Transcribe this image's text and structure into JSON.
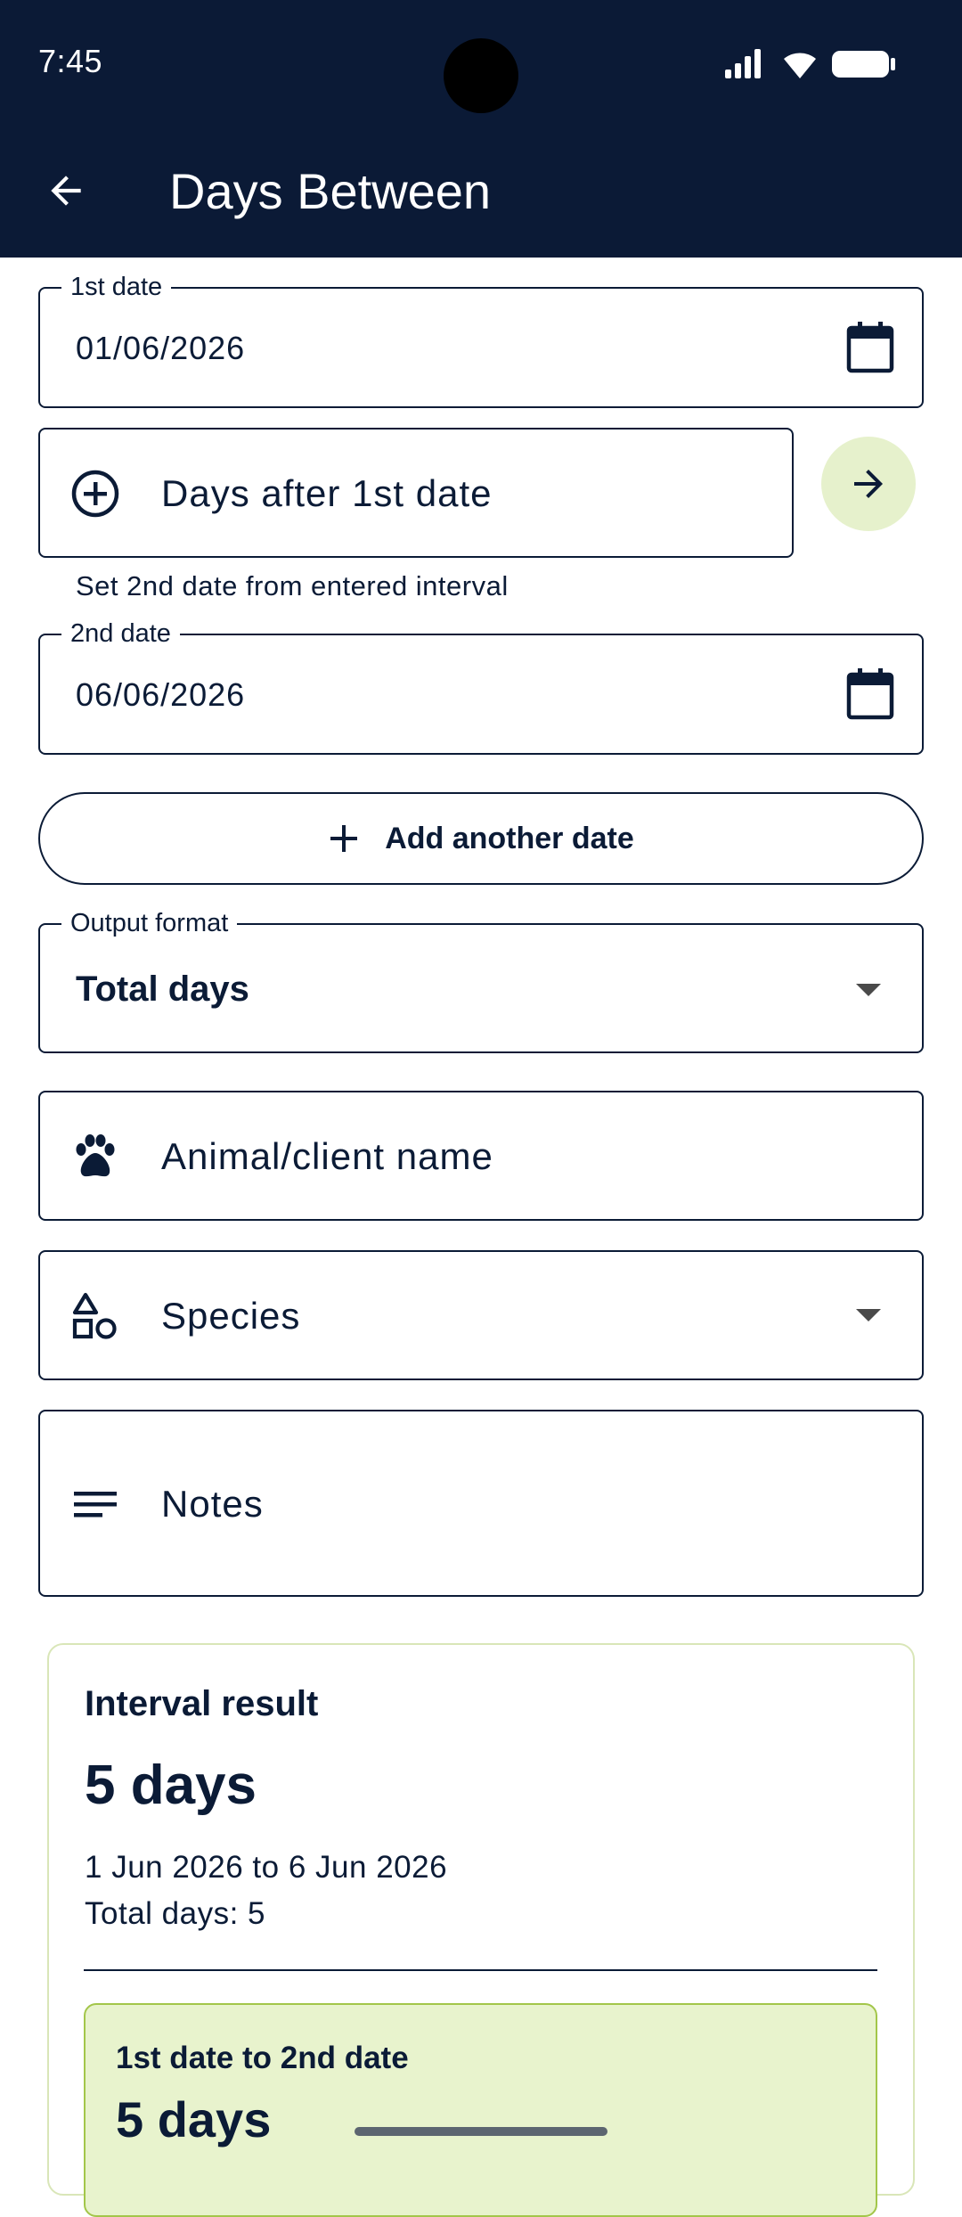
{
  "status_bar": {
    "time": "7:45",
    "icons": [
      "signal-icon",
      "wifi-icon",
      "battery-icon"
    ]
  },
  "app_bar": {
    "title": "Days Between",
    "back_icon": "arrow-back-icon"
  },
  "form": {
    "first_date": {
      "label": "1st date",
      "value": "01/06/2026",
      "icon": "calendar-icon"
    },
    "interval": {
      "placeholder": "Days after 1st date",
      "icon": "add-circle-icon",
      "go_icon": "arrow-forward-icon",
      "helper": "Set 2nd date from entered interval"
    },
    "second_date": {
      "label": "2nd date",
      "value": "06/06/2026",
      "icon": "calendar-icon"
    },
    "add_date": {
      "label": "Add another date",
      "icon": "plus-icon"
    },
    "output_format": {
      "label": "Output format",
      "value": "Total days"
    },
    "animal": {
      "placeholder": "Animal/client name",
      "icon": "paw-icon"
    },
    "species": {
      "placeholder": "Species",
      "icon": "shapes-icon"
    },
    "notes": {
      "placeholder": "Notes",
      "icon": "notes-icon"
    }
  },
  "result": {
    "title": "Interval result",
    "big": "5 days",
    "range": "1 Jun 2026 to 6 Jun 2026",
    "total": "Total days: 5",
    "segment": {
      "title": "1st date to 2nd date",
      "big": "5 days"
    }
  },
  "colors": {
    "app_bar": "#0b1a36",
    "ink": "#0b1b36",
    "accent_soft": "#e6f1cc",
    "segment_bg": "#e8f3cd",
    "segment_border": "#a3c64a"
  }
}
